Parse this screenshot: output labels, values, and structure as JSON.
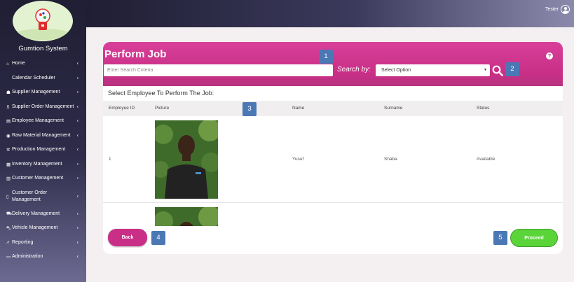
{
  "app": {
    "brand": "Gumtion System"
  },
  "user": {
    "name": "Tester"
  },
  "sidebar": {
    "items": [
      {
        "icon": "home-icon",
        "glyph": "⌂",
        "label": "Home"
      },
      {
        "icon": "",
        "glyph": "",
        "label": "Calendar Scheduler"
      },
      {
        "icon": "users-icon",
        "glyph": "☗",
        "label": "Supplier Management"
      },
      {
        "icon": "cart-icon",
        "glyph": "⊻",
        "label": "Supplier Order Management"
      },
      {
        "icon": "employee-icon",
        "glyph": "▤",
        "label": "Employee Management"
      },
      {
        "icon": "leaf-icon",
        "glyph": "◉",
        "label": "Raw Material Management"
      },
      {
        "icon": "cogs-icon",
        "glyph": "✲",
        "label": "Production Management"
      },
      {
        "icon": "inventory-icon",
        "glyph": "▦",
        "label": "Inventory Management"
      },
      {
        "icon": "customer-icon",
        "glyph": "▥",
        "label": "Customer Management"
      },
      {
        "icon": "file-icon",
        "glyph": "▯",
        "label": "Customer Order Management"
      },
      {
        "icon": "truck-icon",
        "glyph": "⛟",
        "label": "Delivery Management"
      },
      {
        "icon": "car-icon",
        "glyph": "⛍",
        "label": "Vehicle Management"
      },
      {
        "icon": "chart-icon",
        "glyph": "⩘",
        "label": "Reporting"
      },
      {
        "icon": "laptop-icon",
        "glyph": "▭",
        "label": "Administration"
      }
    ]
  },
  "page": {
    "title": "Perform Job",
    "help": "?",
    "search_placeholder": "Enter Search Criteria",
    "search_by_label": "Search by:",
    "select_value": "Select Option",
    "select_employee_label": "Select Employee To Perform The Job:"
  },
  "badges": [
    "1",
    "2",
    "3",
    "4",
    "5"
  ],
  "table": {
    "headers": [
      "Employee ID",
      "Picture",
      "Name",
      "Surname",
      "Status"
    ],
    "rows": [
      {
        "id": "1",
        "name": "Yusuf",
        "surname": "Shaba",
        "status": "Available"
      }
    ]
  },
  "buttons": {
    "back": "Back",
    "proceed": "Proceed"
  },
  "colors": {
    "accent": "#c92f86",
    "proceed": "#5bd43a",
    "badge": "#4a78b5"
  }
}
